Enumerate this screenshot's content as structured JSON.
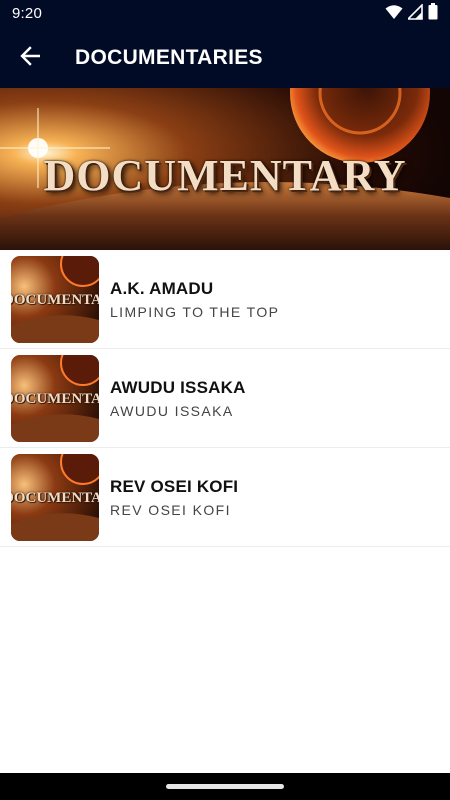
{
  "status_bar": {
    "time": "9:20"
  },
  "app_bar": {
    "title": "DOCUMENTARIES"
  },
  "banner": {
    "text": "DOCUMENTARY"
  },
  "items": [
    {
      "title": "A.K. AMADU",
      "subtitle": "LIMPING TO THE TOP",
      "thumb_text": "DOCUMENTARY"
    },
    {
      "title": "AWUDU ISSAKA",
      "subtitle": "AWUDU ISSAKA",
      "thumb_text": "DOCUMENTARY"
    },
    {
      "title": "REV OSEI KOFI",
      "subtitle": "REV OSEI KOFI",
      "thumb_text": "DOCUMENTARY"
    }
  ],
  "colors": {
    "app_bar": "#020b26",
    "banner_text": "#f3ddc4"
  }
}
